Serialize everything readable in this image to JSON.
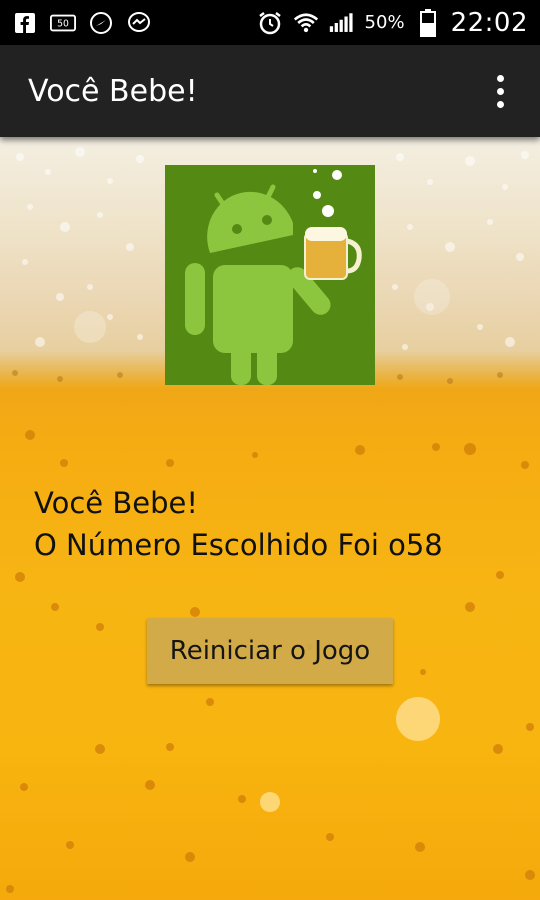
{
  "status_bar": {
    "battery_percent": "50%",
    "time": "22:02",
    "icons_left": [
      "facebook-icon",
      "subtitles-icon",
      "navigation-icon",
      "messenger-icon"
    ],
    "icons_right": [
      "alarm-icon",
      "wifi-icon",
      "signal-icon",
      "battery-icon"
    ]
  },
  "action_bar": {
    "title": "Você Bebe!",
    "overflow_icon": "overflow-menu-icon"
  },
  "content": {
    "result_line1": "Você Bebe!",
    "result_line2": "O Número Escolhido Foi o58",
    "restart_button": "Reiniciar o Jogo"
  },
  "colors": {
    "logo_bg": "#548a13",
    "android_green": "#8cc63e",
    "beer_yellow": "#f7b513"
  }
}
